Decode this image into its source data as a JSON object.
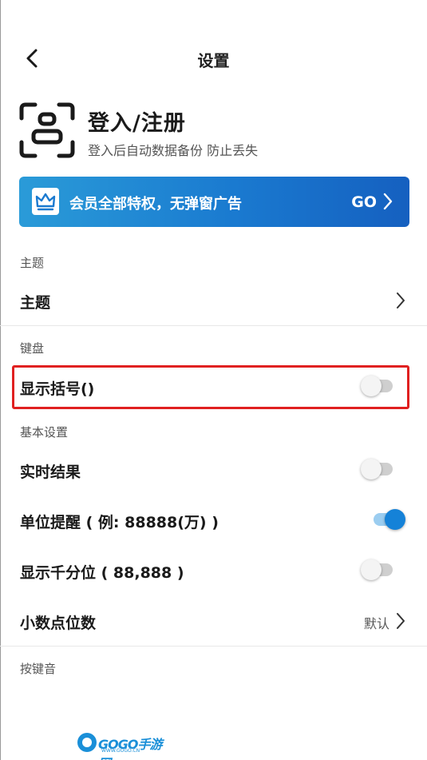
{
  "header": {
    "title": "设置"
  },
  "login": {
    "title": "登入/注册",
    "subtitle": "登入后自动数据备份 防止丢失"
  },
  "vip": {
    "text": "会员全部特权，无弹窗广告",
    "go": "GO"
  },
  "sections": {
    "theme": {
      "label": "主题",
      "rows": {
        "theme": {
          "label": "主题"
        }
      }
    },
    "keyboard": {
      "label": "键盘",
      "rows": {
        "show_brackets": {
          "label": "显示括号()",
          "on": false
        }
      }
    },
    "basic": {
      "label": "基本设置",
      "rows": {
        "realtime": {
          "label": "实时结果",
          "on": false
        },
        "unit_hint": {
          "label": "单位提醒 ( 例: 88888(万) )",
          "on": true
        },
        "thousands": {
          "label": "显示千分位 ( 88,888 )",
          "on": false
        },
        "decimals": {
          "label": "小数点位数",
          "value": "默认"
        }
      }
    },
    "keysound": {
      "label": "按键音"
    }
  },
  "watermark": {
    "brand": "GOGO手游网",
    "domain": "WWW.GOGO.CN"
  },
  "colors": {
    "accent": "#1582d8",
    "highlight": "#e02020",
    "vip_start": "#2a9bd8",
    "vip_end": "#1560c0"
  }
}
